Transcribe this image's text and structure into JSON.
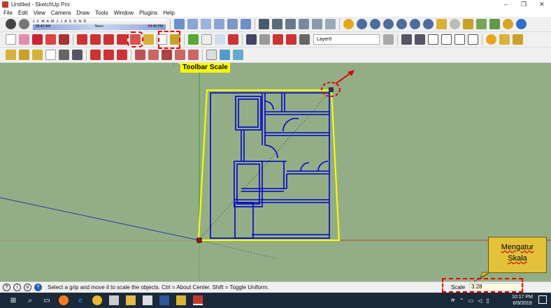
{
  "window": {
    "title": "Untitled - SketchUp Pro",
    "minimize": "–",
    "maximize": "❐",
    "close": "✕"
  },
  "menu": [
    "File",
    "Edit",
    "View",
    "Camera",
    "Draw",
    "Tools",
    "Window",
    "Plugins",
    "Help"
  ],
  "shadow": {
    "months": "J F M A M J J A S O N D",
    "time_start": "06:42 AM",
    "time_noon": "Noon",
    "time_end": "04:46 PM"
  },
  "layer": {
    "value": "Layer0"
  },
  "callouts": {
    "toolbar_scale": "Toolbar Scale",
    "mengatur": "Mengatur",
    "skala": "Skala"
  },
  "status": {
    "message": "Select a grip and move it to scale the objects. Ctrl = About Center. Shift = Toggle Uniform.",
    "scale_label": "Scale",
    "scale_value": "3.28"
  },
  "taskbar": {
    "time": "10:17 PM",
    "date": "6/9/2019",
    "ime": "ጽ"
  },
  "colors": {
    "viewport": "#93ae86",
    "plan_lines": "#0000cc",
    "selection": "#ffff00",
    "highlight": "#e00000",
    "callout": "#e3c23a"
  }
}
